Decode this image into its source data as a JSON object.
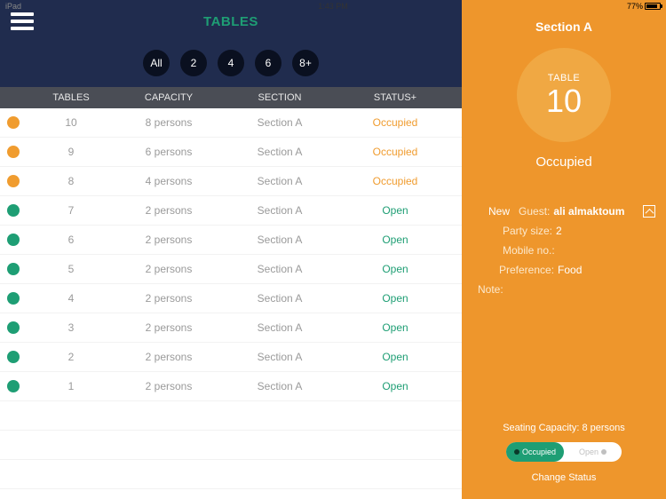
{
  "status_bar": {
    "carrier": "iPad",
    "time": "1:43 PM",
    "battery": "77%"
  },
  "header": {
    "title": "TABLES"
  },
  "filters": [
    "All",
    "2",
    "4",
    "6",
    "8+"
  ],
  "columns": {
    "tables": "TABLES",
    "capacity": "CAPACITY",
    "section": "SECTION",
    "status": "STATUS+"
  },
  "rows": [
    {
      "table": "10",
      "capacity": "8 persons",
      "section": "Section A",
      "status": "Occupied",
      "status_type": "occupied"
    },
    {
      "table": "9",
      "capacity": "6 persons",
      "section": "Section A",
      "status": "Occupied",
      "status_type": "occupied"
    },
    {
      "table": "8",
      "capacity": "4 persons",
      "section": "Section A",
      "status": "Occupied",
      "status_type": "occupied"
    },
    {
      "table": "7",
      "capacity": "2 persons",
      "section": "Section A",
      "status": "Open",
      "status_type": "open"
    },
    {
      "table": "6",
      "capacity": "2 persons",
      "section": "Section A",
      "status": "Open",
      "status_type": "open"
    },
    {
      "table": "5",
      "capacity": "2 persons",
      "section": "Section A",
      "status": "Open",
      "status_type": "open"
    },
    {
      "table": "4",
      "capacity": "2 persons",
      "section": "Section A",
      "status": "Open",
      "status_type": "open"
    },
    {
      "table": "3",
      "capacity": "2 persons",
      "section": "Section A",
      "status": "Open",
      "status_type": "open"
    },
    {
      "table": "2",
      "capacity": "2 persons",
      "section": "Section A",
      "status": "Open",
      "status_type": "open"
    },
    {
      "table": "1",
      "capacity": "2 persons",
      "section": "Section A",
      "status": "Open",
      "status_type": "open"
    }
  ],
  "detail": {
    "section": "Section A",
    "table_label": "TABLE",
    "table_number": "10",
    "status": "Occupied",
    "new_label": "New",
    "guest_label": "Guest:",
    "guest_name": "ali almaktoum",
    "party_size_label": "Party size:",
    "party_size_value": "2",
    "mobile_label": "Mobile no.:",
    "mobile_value": "",
    "preference_label": "Preference:",
    "preference_value": "Food",
    "note_label": "Note:",
    "note_value": "",
    "seating_label": "Seating Capacity:",
    "seating_value": "8 persons",
    "toggle_occupied": "Occupied",
    "toggle_open": "Open",
    "change_status": "Change Status"
  }
}
